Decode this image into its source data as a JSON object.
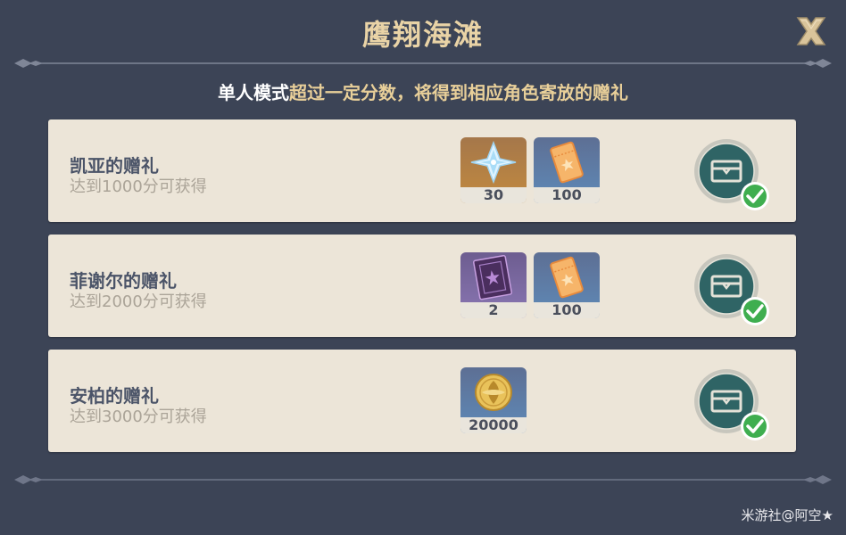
{
  "header": {
    "title": "鹰翔海滩",
    "close_label": "close"
  },
  "subtitle": {
    "mode": "单人模式",
    "rest": "超过一定分数，将得到相应角色寄放的赠礼"
  },
  "rewards": [
    {
      "name": "凯亚的赠礼",
      "requirement": "达到1000分可获得",
      "items": [
        {
          "icon": "primogem-icon",
          "quantity": "30"
        },
        {
          "icon": "ticket-icon",
          "quantity": "100"
        }
      ],
      "claimed": true
    },
    {
      "name": "菲谢尔的赠礼",
      "requirement": "达到2000分可获得",
      "items": [
        {
          "icon": "book-icon",
          "quantity": "2"
        },
        {
          "icon": "ticket-icon",
          "quantity": "100"
        }
      ],
      "claimed": true
    },
    {
      "name": "安柏的赠礼",
      "requirement": "达到3000分可获得",
      "items": [
        {
          "icon": "mora-coin-icon",
          "quantity": "20000"
        }
      ],
      "claimed": true
    }
  ],
  "watermark": "米游社@阿空★",
  "colors": {
    "background": "#3c4456",
    "card": "#ece5d8",
    "title": "#e9d3a6",
    "check": "#3fae4f",
    "chest": "#2f6465"
  }
}
